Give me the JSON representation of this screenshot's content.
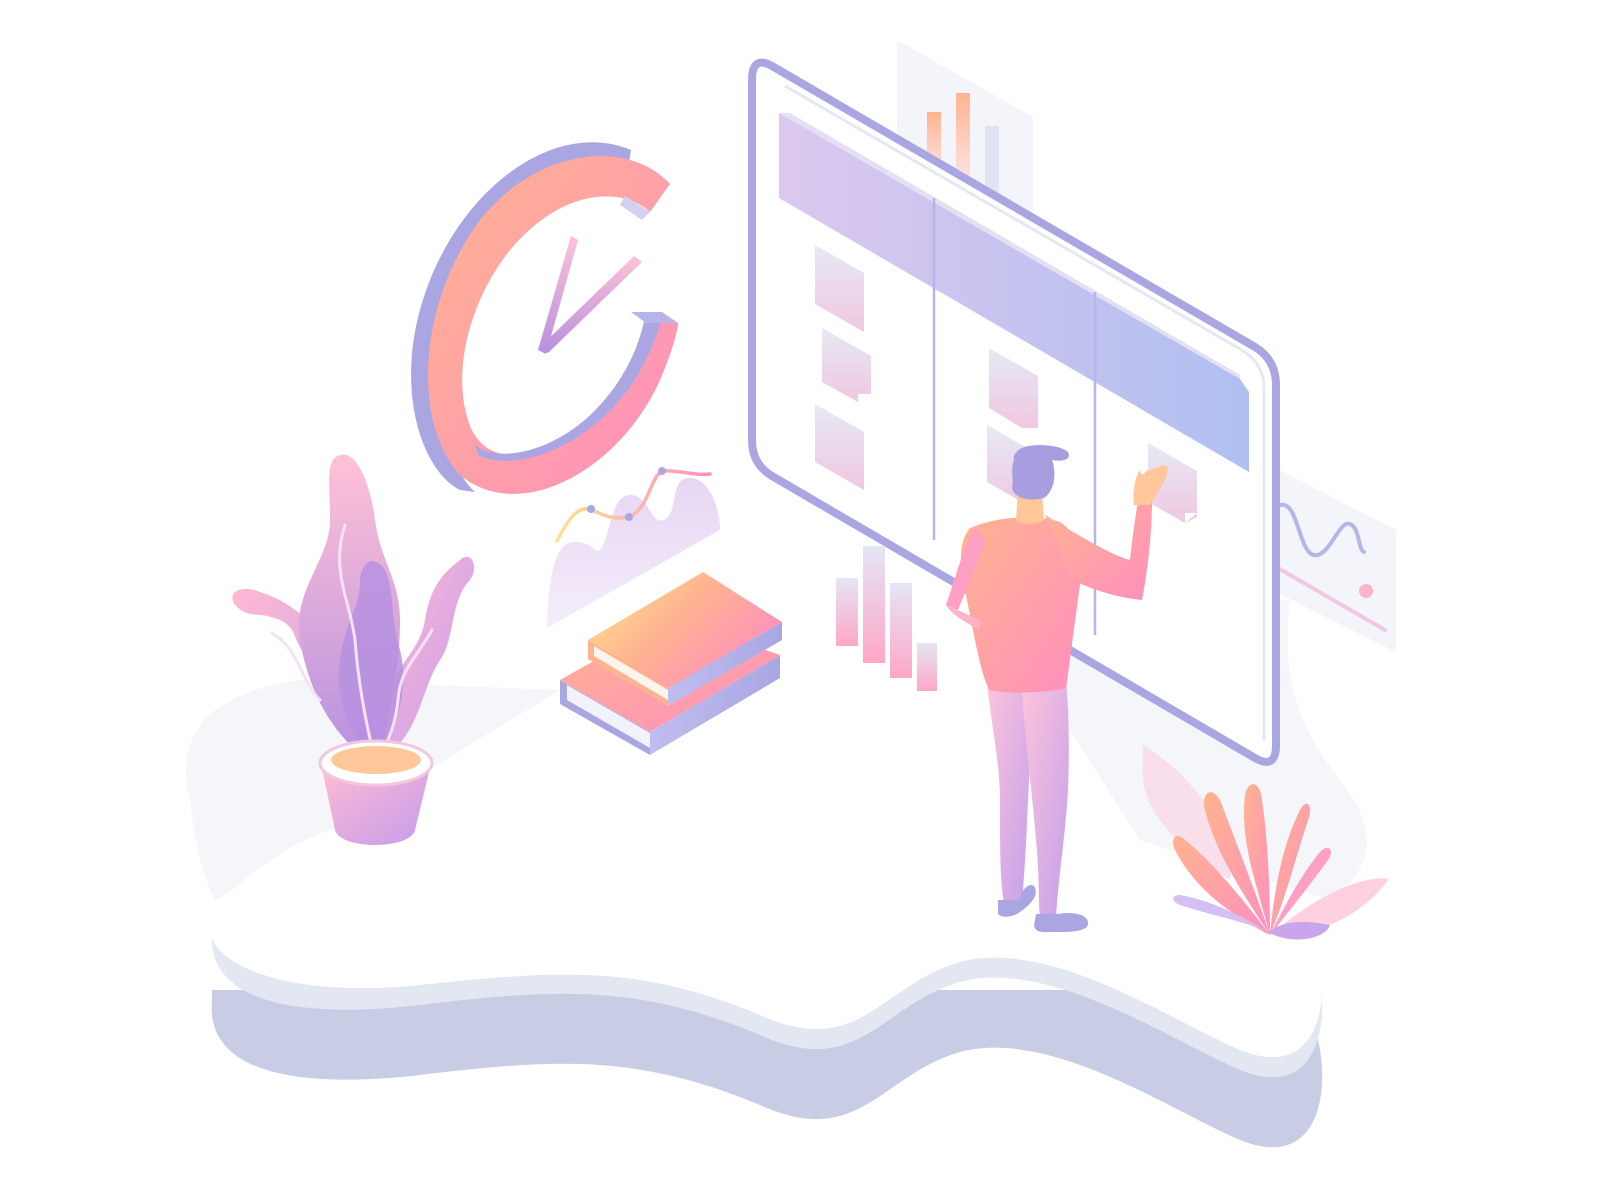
{
  "illustration": {
    "subject": "person-at-kanban-board",
    "icons": {
      "clock": "clock-icon",
      "books": "books-icon",
      "plant": "potted-plant-icon",
      "bush": "leafy-bush-icon",
      "person": "person-icon"
    }
  },
  "colors": {
    "frame": "#a9a6e2",
    "lavender": "#b7b4ea",
    "pink": "#ff8fbf",
    "peach": "#ffb38f",
    "yellow": "#ffe98f",
    "platform_top": "#ffffff",
    "platform_side_1": "#e3e7f1",
    "platform_side_2": "#c8cce4",
    "shadow": "#f5f6fa",
    "board_header_start": "#dcc8ee",
    "board_header_end": "#b0bff0",
    "card": "#eddcee",
    "hair": "#a79ee0"
  }
}
